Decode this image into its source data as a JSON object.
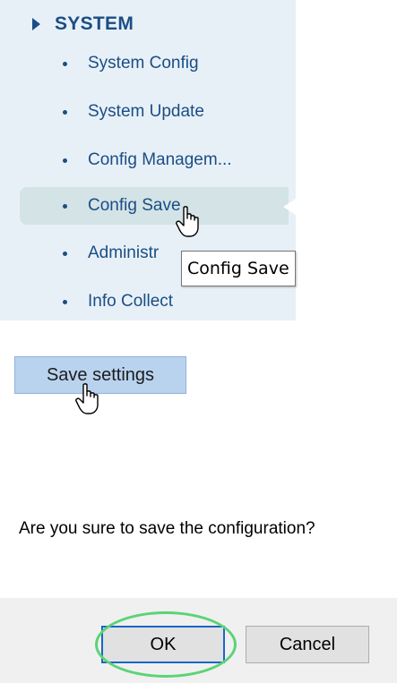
{
  "menu": {
    "section_label": "SYSTEM",
    "items": [
      {
        "label": "System Config"
      },
      {
        "label": "System Update"
      },
      {
        "label": "Config Managem..."
      },
      {
        "label": "Config Save",
        "active": true
      },
      {
        "label": "Administr"
      },
      {
        "label": "Info Collect"
      }
    ]
  },
  "tooltip": {
    "text": "Config Save"
  },
  "save_button": {
    "label": "Save settings"
  },
  "dialog": {
    "question": "Are you sure to save the configuration?",
    "ok_label": "OK",
    "cancel_label": "Cancel"
  },
  "colors": {
    "menu_text": "#1a4e85",
    "menu_bg": "#e8f0f7",
    "active_item_bg": "#d3e3e6",
    "save_button_bg": "#b9d3ef",
    "ok_border": "#1a66c7",
    "highlight": "#5cd376"
  },
  "icons": [
    "expand-triangle-icon",
    "bullet-icon",
    "hand-pointer-cursor-icon"
  ]
}
